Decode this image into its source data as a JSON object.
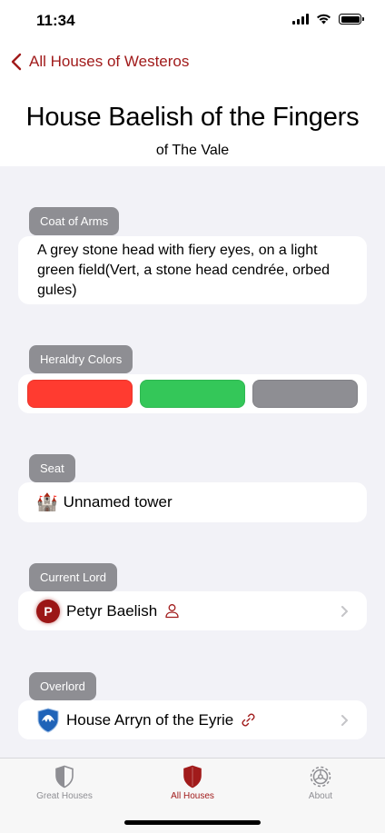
{
  "status_bar": {
    "time": "11:34"
  },
  "nav": {
    "back_label": "All Houses of Westeros"
  },
  "house": {
    "name": "House Baelish of the Fingers",
    "region": "of The Vale"
  },
  "coat_of_arms": {
    "label": "Coat of Arms",
    "text": "A grey stone head with fiery eyes, on a light green field(Vert, a stone head cendrée, orbed gules)"
  },
  "heraldry": {
    "label": "Heraldry Colors",
    "colors": [
      "#ff3b30",
      "#34c759",
      "#8e8e93"
    ]
  },
  "seat": {
    "label": "Seat",
    "value": "Unnamed tower",
    "icon": "castle-icon"
  },
  "current_lord": {
    "label": "Current Lord",
    "name": "Petyr Baelish",
    "initial": "P",
    "icon": "person-icon"
  },
  "overlord": {
    "label": "Overlord",
    "name": "House Arryn of the Eyrie",
    "icon": "link-icon"
  },
  "tabs": [
    {
      "label": "Great Houses",
      "icon": "shield-icon",
      "active": false
    },
    {
      "label": "All Houses",
      "icon": "shield-fill-icon",
      "active": true
    },
    {
      "label": "About",
      "icon": "gear-icon",
      "active": false
    }
  ],
  "colors": {
    "accent": "#a11b1b",
    "label_bg": "#8e8e93",
    "background": "#f2f2f7"
  }
}
